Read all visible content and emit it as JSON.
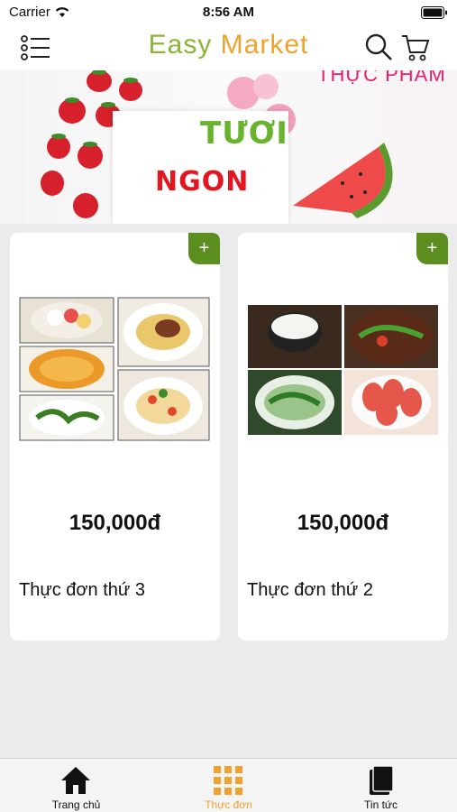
{
  "status_bar": {
    "carrier": "Carrier",
    "time": "8:56 AM"
  },
  "header": {
    "title_part1": "Easy",
    "title_part2": "Market"
  },
  "banner": {
    "text_fresh": "TƯƠI",
    "text_tasty": "NGON",
    "text_food": "THỰC PHẨM"
  },
  "products": [
    {
      "name": "Thực đơn thứ 3",
      "price": "150,000đ",
      "add_label": "+"
    },
    {
      "name": "Thực đơn thứ 2",
      "price": "150,000đ",
      "add_label": "+"
    }
  ],
  "tabs": [
    {
      "label": "Trang chủ",
      "icon": "home-icon"
    },
    {
      "label": "Thực đơn",
      "icon": "grid-icon"
    },
    {
      "label": "Tin tức",
      "icon": "book-icon"
    }
  ],
  "colors": {
    "brand_green": "#8ab535",
    "brand_orange": "#f2a12c",
    "add_button": "#5c8e1f"
  }
}
